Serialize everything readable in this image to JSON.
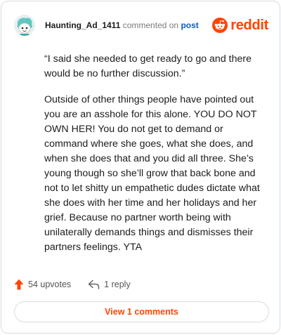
{
  "comment": {
    "author": "Haunting_Ad_1411",
    "action_text": "commented on",
    "target_link": "post",
    "avatar_icon": "snoo-avatar-icon",
    "quote": "“I said she needed to get ready to go and there would be no further discussion.”",
    "body": "Outside of other things people have pointed out you are an asshole for this alone. YOU DO NOT OWN HER! You do not get to demand or command where she goes, what she does, and when she does that and you did all three. She’s young though so she’ll grow that back bone and not to let shitty un empathetic dudes dictate what she does with her time and her holidays and her grief. Because no partner worth being with unilaterally demands things and dismisses their partners feelings. YTA"
  },
  "brand": {
    "name": "reddit",
    "icon": "reddit-logo-icon",
    "color": "#ff4500"
  },
  "footer": {
    "upvotes_label": "54 upvotes",
    "upvote_icon": "upvote-arrow-icon",
    "replies_label": "1 reply",
    "reply_icon": "reply-arrow-icon"
  },
  "actions": {
    "view_comments_label": "View 1 comments"
  },
  "colors": {
    "accent": "#ff4500",
    "link": "#0b5ec6",
    "border": "#d9dcdf"
  }
}
